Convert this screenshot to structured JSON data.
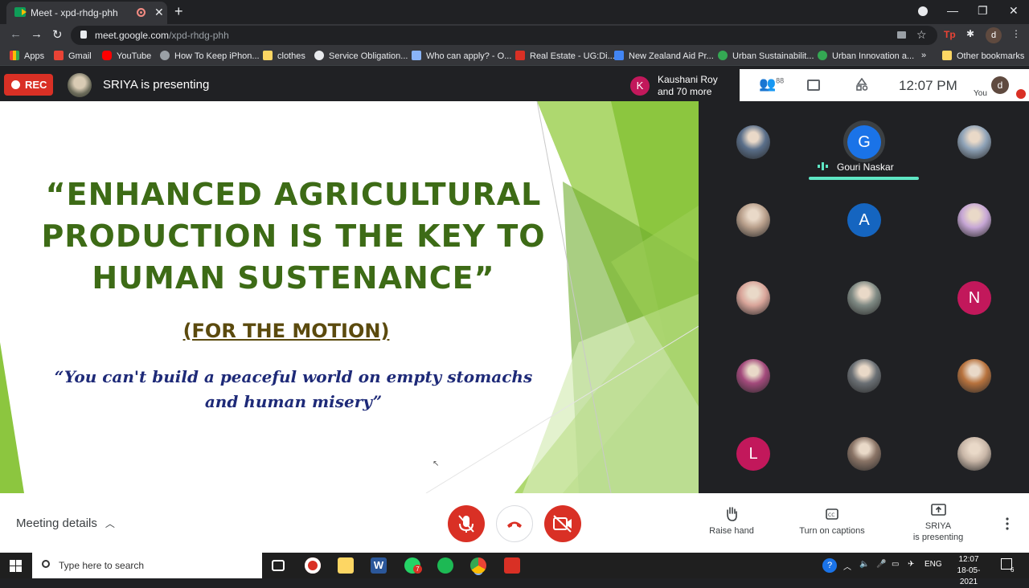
{
  "browser": {
    "tab_title": "Meet - xpd-rhdg-phh",
    "url_host": "meet.google.com",
    "url_path": "/xpd-rhdg-phh",
    "profile_initial": "d",
    "bookmarks": [
      {
        "label": "Apps",
        "color": "#ea4335"
      },
      {
        "label": "Gmail",
        "color": "#ea4335"
      },
      {
        "label": "YouTube",
        "color": "#ff0000"
      },
      {
        "label": "How To Keep iPhon...",
        "color": "#9aa0a6"
      },
      {
        "label": "clothes",
        "color": "#fdd663"
      },
      {
        "label": "Service Obligation...",
        "color": "#e8eaed"
      },
      {
        "label": "Who can apply? - O...",
        "color": "#8ab4f8"
      },
      {
        "label": "Real Estate - UG:Di...",
        "color": "#d93025"
      },
      {
        "label": "New Zealand Aid Pr...",
        "color": "#4285f4"
      },
      {
        "label": "Urban Sustainabilit...",
        "color": "#34a853"
      },
      {
        "label": "Urban Innovation a...",
        "color": "#34a853"
      }
    ],
    "bookmarks_overflow": "»",
    "other_bookmarks": "Other bookmarks"
  },
  "meet": {
    "rec_label": "REC",
    "presenting_text": "SRIYA is presenting",
    "recent_speaker_initial": "K",
    "recent_speaker_line1": "Kaushani Roy",
    "recent_speaker_line2": "and 70 more",
    "people_count": "88",
    "clock": "12:07 PM",
    "self_initial": "d",
    "self_label": "You"
  },
  "slide": {
    "title": "“ENHANCED AGRICULTURAL PRODUCTION IS THE KEY TO HUMAN SUSTENANCE”",
    "subtitle": "(FOR THE MOTION)",
    "quote": "“You can't build a peaceful world on empty stomachs and human misery”"
  },
  "participants": {
    "active_speaker_initial": "G",
    "active_speaker_name": "Gouri Naskar",
    "tiles": [
      {
        "kind": "photo",
        "color": "#5a6f8a"
      },
      {
        "kind": "speaker",
        "initial": "G",
        "color": "#1a73e8"
      },
      {
        "kind": "photo",
        "color": "#8fa3b8"
      },
      {
        "kind": "photo",
        "color": "#b9a08c"
      },
      {
        "kind": "letter",
        "initial": "A",
        "color": "#1565c0"
      },
      {
        "kind": "photo",
        "color": "#c7a7d6"
      },
      {
        "kind": "photo",
        "color": "#d9a59a"
      },
      {
        "kind": "photo",
        "color": "#7f8a84"
      },
      {
        "kind": "letter",
        "initial": "N",
        "color": "#c2185b"
      },
      {
        "kind": "photo",
        "color": "#a34a7c"
      },
      {
        "kind": "photo",
        "color": "#6b7075"
      },
      {
        "kind": "photo",
        "color": "#b8733e"
      },
      {
        "kind": "letter",
        "initial": "L",
        "color": "#c2185b"
      },
      {
        "kind": "photo",
        "color": "#8a7466"
      },
      {
        "kind": "photo",
        "color": "#c9b7a8"
      }
    ]
  },
  "controls": {
    "meeting_details": "Meeting details",
    "raise_hand": "Raise hand",
    "captions": "Turn on captions",
    "present_line1": "SRIYA",
    "present_line2": "is presenting"
  },
  "taskbar": {
    "search_placeholder": "Type here to search",
    "chat_badge": "7",
    "language": "ENG",
    "time": "12:07",
    "date": "18-05-2021",
    "notification_count": "6"
  },
  "colors": {
    "rec_red": "#d93025",
    "slide_green": "#3d6b16",
    "quote_blue": "#1e2a78",
    "speaker_teal": "#5ee6c4"
  }
}
